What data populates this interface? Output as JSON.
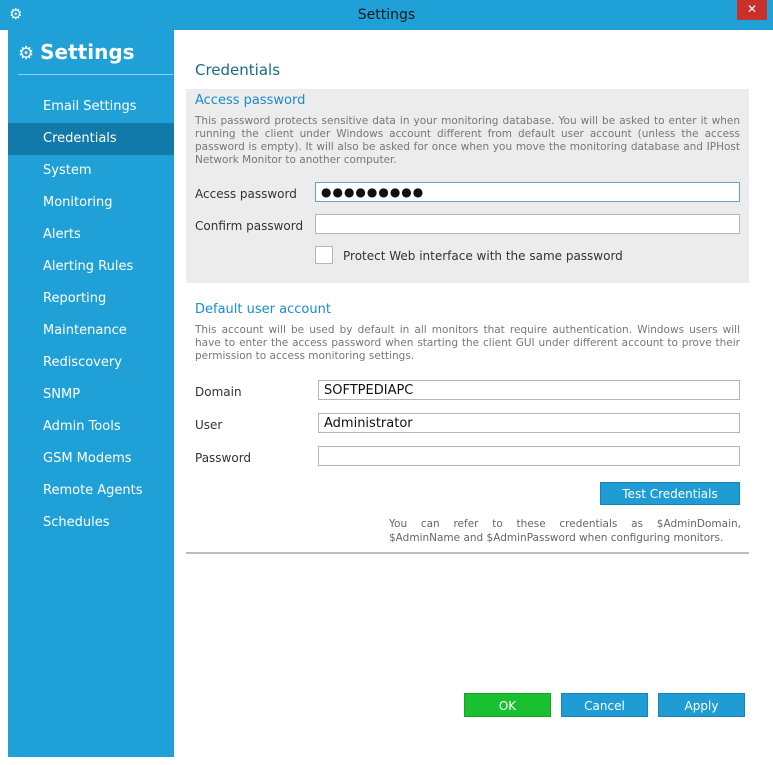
{
  "window": {
    "title": "Settings",
    "close_label": "✕",
    "accent": "#1fa1d8"
  },
  "sidebar": {
    "header": "Settings",
    "items": [
      {
        "label": "Email Settings"
      },
      {
        "label": "Credentials"
      },
      {
        "label": "System"
      },
      {
        "label": "Monitoring"
      },
      {
        "label": "Alerts"
      },
      {
        "label": "Alerting Rules"
      },
      {
        "label": "Reporting"
      },
      {
        "label": "Maintenance"
      },
      {
        "label": "Rediscovery"
      },
      {
        "label": "SNMP"
      },
      {
        "label": "Admin Tools"
      },
      {
        "label": "GSM Modems"
      },
      {
        "label": "Remote Agents"
      },
      {
        "label": "Schedules"
      }
    ],
    "active": "Credentials"
  },
  "main": {
    "title": "Credentials",
    "access": {
      "title": "Access password",
      "description": "This password protects sensitive data in your monitoring database. You will be asked to enter it when running the client under Windows account different from default user account (unless the access password is empty). It will also be asked for once when you move the monitoring database and IPHost Network Monitor to another computer.",
      "password_label": "Access password",
      "password_value": "●●●●●●●●●",
      "confirm_label": "Confirm password",
      "confirm_value": "",
      "protect_label": "Protect Web interface with the same password"
    },
    "default_account": {
      "title": "Default user account",
      "description": "This account will be used by default in all monitors that require authentication. Windows users will have to enter the access password when starting the client GUI under different account to prove their permission to access monitoring settings.",
      "domain_label": "Domain",
      "domain_value": "SOFTPEDIAPC",
      "user_label": "User",
      "user_value": "Administrator",
      "password_label": "Password",
      "password_value": "",
      "test_button": "Test Credentials",
      "note": "You can refer to these credentials as $AdminDomain, $AdminName and $AdminPassword when configuring monitors."
    }
  },
  "footer": {
    "ok": "OK",
    "cancel": "Cancel",
    "apply": "Apply"
  }
}
